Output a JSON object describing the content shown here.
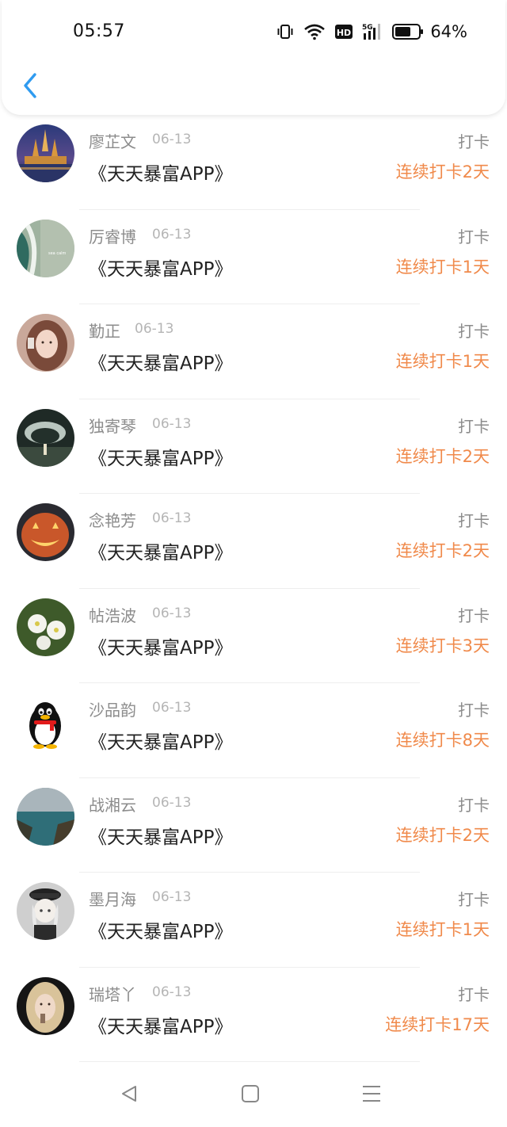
{
  "status_bar": {
    "time": "05:57",
    "battery_text": "64%",
    "icons": [
      "vibrate-icon",
      "wifi-icon",
      "hd-icon",
      "signal-5g-icon",
      "battery-icon"
    ]
  },
  "header": {
    "back_icon": "chevron-left-icon"
  },
  "colors": {
    "accent_orange": "#f08a4b",
    "back_blue": "#2f9bf0",
    "muted": "#8c8c8c"
  },
  "list": {
    "rows": [
      {
        "name": "廖芷文",
        "date": "06-13",
        "title": "《天天暴富APP》",
        "action": "打卡",
        "streak": "连续打卡2天",
        "avatar": "temple-night-avatar"
      },
      {
        "name": "厉睿博",
        "date": "06-13",
        "title": "《天天暴富APP》",
        "action": "打卡",
        "streak": "连续打卡1天",
        "avatar": "beach-wave-avatar"
      },
      {
        "name": "勤正",
        "date": "06-13",
        "title": "《天天暴富APP》",
        "action": "打卡",
        "streak": "连续打卡1天",
        "avatar": "girl-portrait-avatar"
      },
      {
        "name": "独寄琴",
        "date": "06-13",
        "title": "《天天暴富APP》",
        "action": "打卡",
        "streak": "连续打卡2天",
        "avatar": "arch-landscape-avatar"
      },
      {
        "name": "念艳芳",
        "date": "06-13",
        "title": "《天天暴富APP》",
        "action": "打卡",
        "streak": "连续打卡2天",
        "avatar": "pumpkin-avatar"
      },
      {
        "name": "帖浩波",
        "date": "06-13",
        "title": "《天天暴富APP》",
        "action": "打卡",
        "streak": "连续打卡3天",
        "avatar": "white-flower-avatar"
      },
      {
        "name": "沙品韵",
        "date": "06-13",
        "title": "《天天暴富APP》",
        "action": "打卡",
        "streak": "连续打卡8天",
        "avatar": "penguin-avatar"
      },
      {
        "name": "战湘云",
        "date": "06-13",
        "title": "《天天暴富APP》",
        "action": "打卡",
        "streak": "连续打卡2天",
        "avatar": "sea-cliff-avatar"
      },
      {
        "name": "墨月海",
        "date": "06-13",
        "title": "《天天暴富APP》",
        "action": "打卡",
        "streak": "连续打卡1天",
        "avatar": "anime-officer-avatar"
      },
      {
        "name": "瑞塔丫",
        "date": "06-13",
        "title": "《天天暴富APP》",
        "action": "打卡",
        "streak": "连续打卡17天",
        "avatar": "blonde-portrait-avatar"
      }
    ]
  },
  "navbar": {
    "icons": [
      "back-triangle-icon",
      "home-square-icon",
      "menu-lines-icon"
    ]
  }
}
